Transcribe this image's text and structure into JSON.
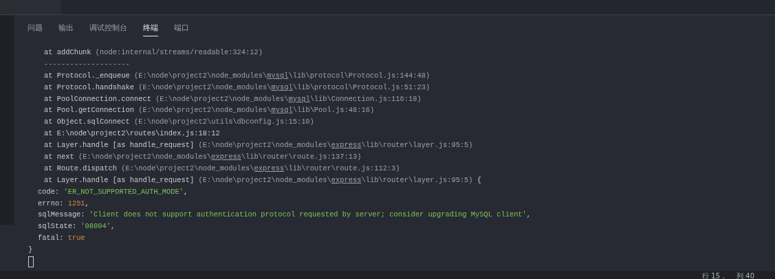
{
  "panel": {
    "tabs": [
      {
        "label": "问题",
        "selected": false
      },
      {
        "label": "输出",
        "selected": false
      },
      {
        "label": "调试控制台",
        "selected": false
      },
      {
        "label": "终端",
        "selected": true
      },
      {
        "label": "端口",
        "selected": false
      }
    ]
  },
  "terminal": {
    "lines": [
      {
        "kind": "frame",
        "segments": [
          {
            "kind": "text",
            "text": "at addChunk "
          },
          {
            "kind": "dim",
            "text": "(node:internal/streams/readable:324:12)"
          }
        ]
      },
      {
        "kind": "frame",
        "segments": [
          {
            "kind": "dim",
            "text": "--------------------"
          }
        ]
      },
      {
        "kind": "frame",
        "segments": [
          {
            "kind": "text",
            "text": "at Protocol._enqueue "
          },
          {
            "kind": "dim",
            "text": "(E:\\node\\project2\\node_modules\\"
          },
          {
            "kind": "link",
            "text": "mysql"
          },
          {
            "kind": "dim",
            "text": "\\lib\\protocol\\Protocol.js:144:48)"
          }
        ]
      },
      {
        "kind": "frame",
        "segments": [
          {
            "kind": "text",
            "text": "at Protocol.handshake "
          },
          {
            "kind": "dim",
            "text": "(E:\\node\\project2\\node_modules\\"
          },
          {
            "kind": "link",
            "text": "mysql"
          },
          {
            "kind": "dim",
            "text": "\\lib\\protocol\\Protocol.js:51:23)"
          }
        ]
      },
      {
        "kind": "frame",
        "segments": [
          {
            "kind": "text",
            "text": "at PoolConnection.connect "
          },
          {
            "kind": "dim",
            "text": "(E:\\node\\project2\\node_modules\\"
          },
          {
            "kind": "link",
            "text": "mysql"
          },
          {
            "kind": "dim",
            "text": "\\lib\\Connection.js:116:18)"
          }
        ]
      },
      {
        "kind": "frame",
        "segments": [
          {
            "kind": "text",
            "text": "at Pool.getConnection "
          },
          {
            "kind": "dim",
            "text": "(E:\\node\\project2\\node_modules\\"
          },
          {
            "kind": "link",
            "text": "mysql"
          },
          {
            "kind": "dim",
            "text": "\\lib\\Pool.js:48:16)"
          }
        ]
      },
      {
        "kind": "frame",
        "segments": [
          {
            "kind": "text",
            "text": "at Object.sqlConnect "
          },
          {
            "kind": "dim",
            "text": "(E:\\node\\project2\\utils\\dbconfig.js:15:10)"
          }
        ]
      },
      {
        "kind": "frame",
        "segments": [
          {
            "kind": "text",
            "text": "at E:\\node\\project2\\routes\\index.js:18:12"
          }
        ]
      },
      {
        "kind": "frame",
        "segments": [
          {
            "kind": "text",
            "text": "at Layer.handle [as handle_request] "
          },
          {
            "kind": "dim",
            "text": "(E:\\node\\project2\\node_modules\\"
          },
          {
            "kind": "link",
            "text": "express"
          },
          {
            "kind": "dim",
            "text": "\\lib\\router\\layer.js:95:5)"
          }
        ]
      },
      {
        "kind": "frame",
        "segments": [
          {
            "kind": "text",
            "text": "at next "
          },
          {
            "kind": "dim",
            "text": "(E:\\node\\project2\\node_modules\\"
          },
          {
            "kind": "link",
            "text": "express"
          },
          {
            "kind": "dim",
            "text": "\\lib\\router\\route.js:137:13)"
          }
        ]
      },
      {
        "kind": "frame",
        "segments": [
          {
            "kind": "text",
            "text": "at Route.dispatch "
          },
          {
            "kind": "dim",
            "text": "(E:\\node\\project2\\node_modules\\"
          },
          {
            "kind": "link",
            "text": "express"
          },
          {
            "kind": "dim",
            "text": "\\lib\\router\\route.js:112:3)"
          }
        ]
      },
      {
        "kind": "frame",
        "segments": [
          {
            "kind": "text",
            "text": "at Layer.handle [as handle_request] "
          },
          {
            "kind": "dim",
            "text": "(E:\\node\\project2\\node_modules\\"
          },
          {
            "kind": "link",
            "text": "express"
          },
          {
            "kind": "dim",
            "text": "\\lib\\router\\layer.js:95:5)"
          },
          {
            "kind": "text",
            "text": " {"
          }
        ]
      },
      {
        "kind": "property",
        "segments": [
          {
            "kind": "text",
            "text": "code: "
          },
          {
            "kind": "string",
            "text": "'ER_NOT_SUPPORTED_AUTH_MODE'"
          },
          {
            "kind": "text",
            "text": ","
          }
        ]
      },
      {
        "kind": "property",
        "segments": [
          {
            "kind": "text",
            "text": "errno: "
          },
          {
            "kind": "number",
            "text": "1251"
          },
          {
            "kind": "text",
            "text": ","
          }
        ]
      },
      {
        "kind": "property",
        "segments": [
          {
            "kind": "text",
            "text": "sqlMessage: "
          },
          {
            "kind": "string",
            "text": "'Client does not support authentication protocol requested by server; consider upgrading MySQL client'"
          },
          {
            "kind": "text",
            "text": ","
          }
        ]
      },
      {
        "kind": "property",
        "segments": [
          {
            "kind": "text",
            "text": "sqlState: "
          },
          {
            "kind": "string",
            "text": "'08004'"
          },
          {
            "kind": "text",
            "text": ","
          }
        ]
      },
      {
        "kind": "property",
        "segments": [
          {
            "kind": "text",
            "text": "fatal: "
          },
          {
            "kind": "number",
            "text": "true"
          }
        ]
      },
      {
        "kind": "brace",
        "segments": [
          {
            "kind": "text",
            "text": "}"
          }
        ]
      }
    ]
  },
  "status_bar": {
    "items": [
      "行 15，",
      "列 40"
    ]
  }
}
